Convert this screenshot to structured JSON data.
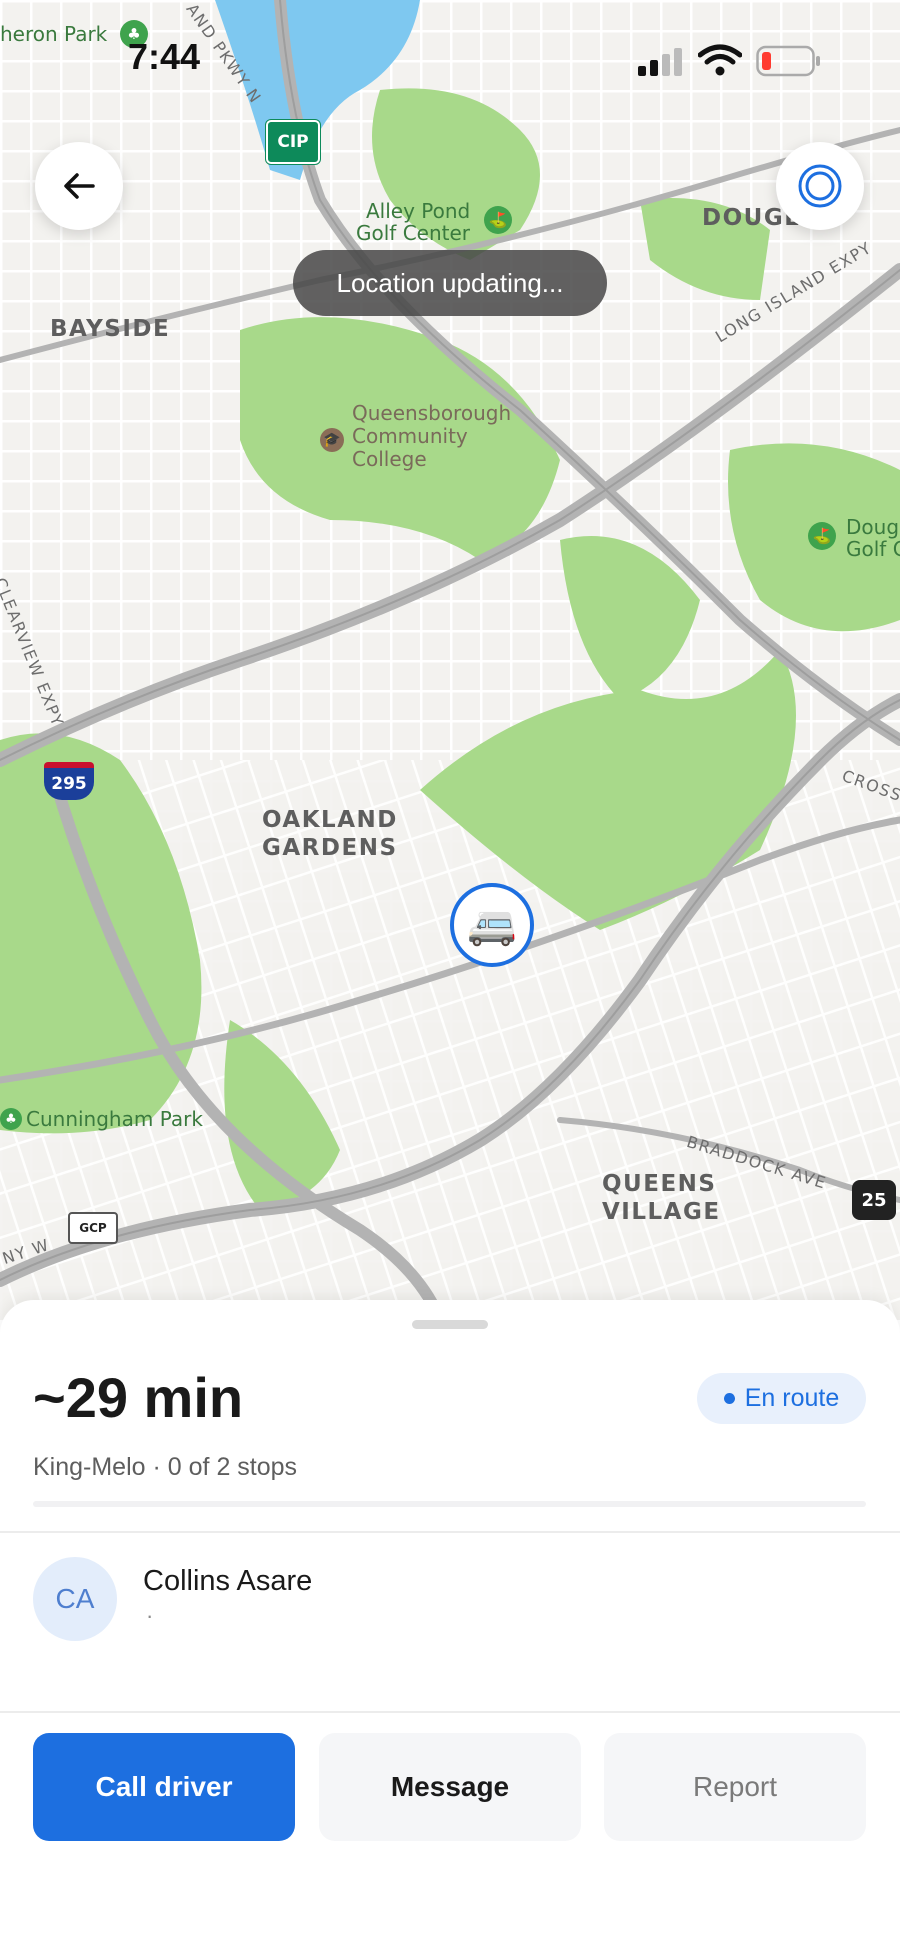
{
  "status_bar": {
    "time": "7:44"
  },
  "map": {
    "toast": "Location updating...",
    "districts": [
      "BAYSIDE",
      "DOUGLAS",
      "OAKLAND",
      "GARDENS",
      "QUEENS",
      "VILLAGE"
    ],
    "pois": {
      "college_1": "Queensborough",
      "college_2": "Community",
      "college_3": "College",
      "golf_1": "Alley Pond",
      "golf_2": "Golf Center",
      "heron": "heron Park",
      "cunningham": "Cunningham Park",
      "doug_1": "Doug",
      "doug_2": "Golf C"
    },
    "roads": {
      "lie": "LONG ISLAND EXPY",
      "clearview": "CLEARVIEW EXPY",
      "braddock": "BRADDOCK AVE",
      "cross": "CROSS",
      "pkwy": "AND PKWY N",
      "nyw": "NY W"
    },
    "shields": {
      "i295": "295",
      "cip": "CIP",
      "gcp": "GCP",
      "r25": "25"
    },
    "vehicle_icon": "minibus-icon"
  },
  "trip": {
    "eta": "~29 min",
    "status": "En route",
    "route": "King-Melo",
    "stops": "0 of 2 stops",
    "stops_completed": 0,
    "stops_total": 2
  },
  "driver": {
    "initials": "CA",
    "name": "Collins Asare",
    "sub": "·"
  },
  "actions": {
    "call": "Call driver",
    "message": "Message",
    "report": "Report"
  },
  "colors": {
    "accent": "#1d6fe0",
    "park": "#a8d98a",
    "water": "#7ec8f0",
    "highway": "#b3b3b3"
  }
}
